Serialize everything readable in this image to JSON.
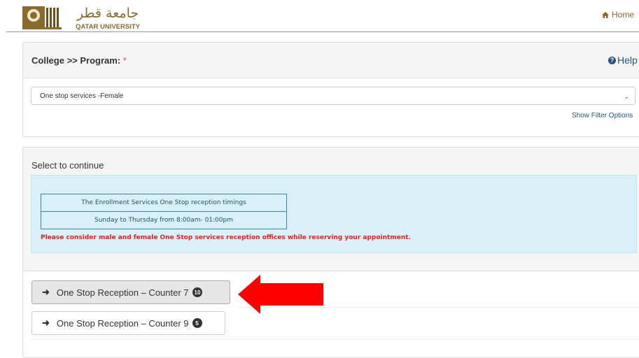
{
  "header": {
    "logo_arabic": "جامعة قطر",
    "logo_english": "QATAR UNIVERSITY",
    "home_label": "Home",
    "home_icon": "home-icon",
    "accent_color": "#8a6a2f"
  },
  "program_panel": {
    "title": "College >> Program:",
    "required_mark": "*",
    "help_label": "Help",
    "help_icon": "question-circle-icon",
    "selected_program": "One stop services -Female",
    "filter_link": "Show Filter Options"
  },
  "continue_panel": {
    "title": "Select to continue",
    "timing_rows": [
      "The Enrollment Services One Stop reception timings",
      "Sunday to Thursday from 8:00am- 01:00pm"
    ],
    "warning": "Please consider male and female One Stop services reception offices while reserving your appointment.",
    "warning_color": "#e0231b",
    "counters": [
      {
        "label": "One Stop Reception – Counter 7",
        "count": "10",
        "selected": true
      },
      {
        "label": "One Stop Reception – Counter 9",
        "count": "5",
        "selected": false
      }
    ]
  },
  "annotation": {
    "arrow_color": "#ff0000",
    "arrow_icon": "red-arrow-left-icon"
  }
}
